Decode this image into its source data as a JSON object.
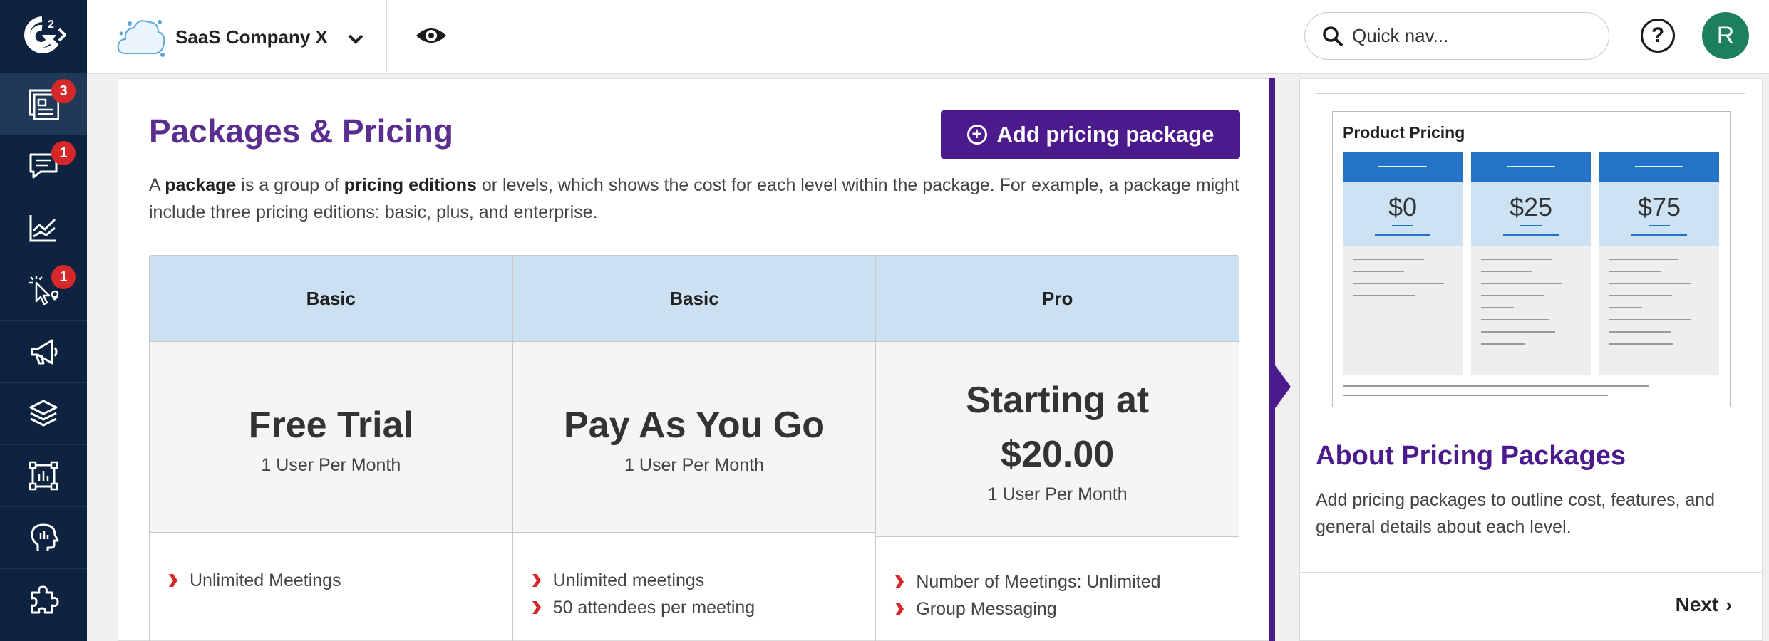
{
  "app": {
    "logo": "G2",
    "company_name": "SaaS Company X",
    "quicknav_placeholder": "Quick nav...",
    "help_label": "?",
    "user_initial": "R"
  },
  "nav": {
    "items": [
      {
        "icon": "listings-icon",
        "badge": "3",
        "active": true
      },
      {
        "icon": "chat-icon",
        "badge": "1"
      },
      {
        "icon": "chart-icon"
      },
      {
        "icon": "click-icon",
        "badge": "1"
      },
      {
        "icon": "megaphone-icon"
      },
      {
        "icon": "layers-icon"
      },
      {
        "icon": "report-icon"
      },
      {
        "icon": "head-icon"
      },
      {
        "icon": "puzzle-icon"
      }
    ]
  },
  "main": {
    "title": "Packages & Pricing",
    "add_button": "Add pricing package",
    "intro": {
      "p1": "A ",
      "b1": "package",
      "p2": " is a group of ",
      "b2": "pricing editions",
      "p3": " or levels, which shows the cost for each level within the package. For example, a package might include three pricing editions: basic, plus, and enterprise."
    },
    "packages": [
      {
        "tier": "Basic",
        "name": "Free Trial",
        "unit": "1 User Per Month",
        "features": [
          "Unlimited Meetings"
        ]
      },
      {
        "tier": "Basic",
        "name": "Pay As You Go",
        "unit": "1 User Per Month",
        "features": [
          "Unlimited meetings",
          "50 attendees per meeting"
        ]
      },
      {
        "tier": "Pro",
        "name_line1": "Starting at",
        "name_line2": "$20.00",
        "unit": "1 User Per Month",
        "features": [
          "Number of Meetings: Unlimited",
          "Group Messaging"
        ]
      }
    ]
  },
  "side": {
    "preview_title": "Product Pricing",
    "preview_prices": [
      "$0",
      "$25",
      "$75"
    ],
    "title": "About Pricing Packages",
    "text": "Add pricing packages to outline cost, features, and general details about each level.",
    "next": "Next"
  },
  "colors": {
    "accent": "#4b1b8e",
    "nav_bg": "#0d2340",
    "badge": "#d6282b",
    "header_blue": "#cbe1f1",
    "avatar": "#1c7f5f"
  }
}
